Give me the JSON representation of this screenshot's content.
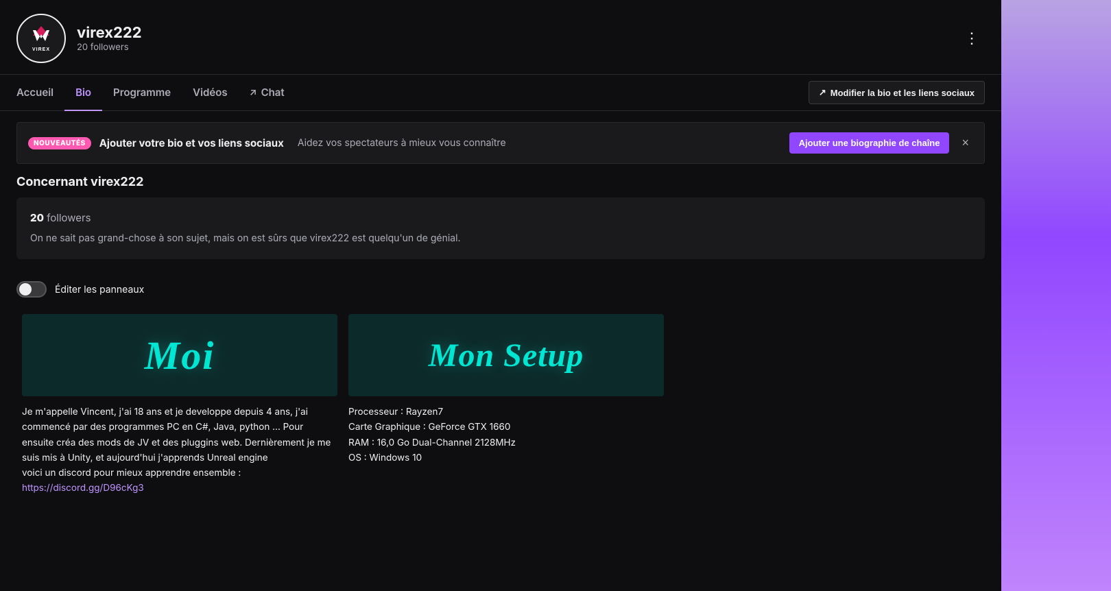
{
  "header": {
    "username": "virex222",
    "followers_count": "20 followers",
    "avatar_letter": "V",
    "avatar_sub": "VIREX",
    "more_options_label": "⋮"
  },
  "nav": {
    "tabs": [
      {
        "id": "accueil",
        "label": "Accueil",
        "active": false,
        "icon": ""
      },
      {
        "id": "bio",
        "label": "Bio",
        "active": true,
        "icon": ""
      },
      {
        "id": "programme",
        "label": "Programme",
        "active": false,
        "icon": ""
      },
      {
        "id": "videos",
        "label": "Vidéos",
        "active": false,
        "icon": ""
      },
      {
        "id": "chat",
        "label": "Chat",
        "active": false,
        "icon": "↗"
      }
    ],
    "modify_btn": "Modifier la bio et les liens sociaux"
  },
  "notification": {
    "badge": "NOUVEAUTÉS",
    "title": "Ajouter votre bio et vos liens sociaux",
    "subtitle": "Aidez vos spectateurs à mieux vous connaître",
    "action_btn": "Ajouter une biographie de chaîne",
    "close": "×"
  },
  "about": {
    "section_title": "Concernant virex222",
    "followers_num": "20",
    "followers_label": " followers",
    "description": "On ne sait pas grand-chose à son sujet, mais on est sûrs que virex222 est quelqu'un de génial."
  },
  "edit_panels": {
    "label": "Éditer les panneaux"
  },
  "panels": [
    {
      "id": "moi",
      "title_display": "Moi",
      "title_type": "moi",
      "bg_color": "#0d2a2a",
      "text": "Je m'appelle Vincent, j'ai 18 ans et je developpe depuis 4 ans, j'ai commencé par des programmes PC en C#, Java, python ... Pour ensuite créa des mods de JV et des pluggins web. Dernièrement je me suis mis à Unity, et aujourd'hui j'apprends Unreal engine\nvoici un discord pour mieux apprendre ensemble :\nhttps://discord.gg/D96cKg3"
    },
    {
      "id": "mon-setup",
      "title_display": "Mon Setup",
      "title_type": "setup",
      "bg_color": "#0d2a2a",
      "specs": [
        "Processeur : Rayzen7",
        "Carte Graphique : GeForce GTX 1660",
        "RAM : 16,0 Go Dual-Channel 2128MHz",
        "OS : Windows 10"
      ]
    }
  ]
}
